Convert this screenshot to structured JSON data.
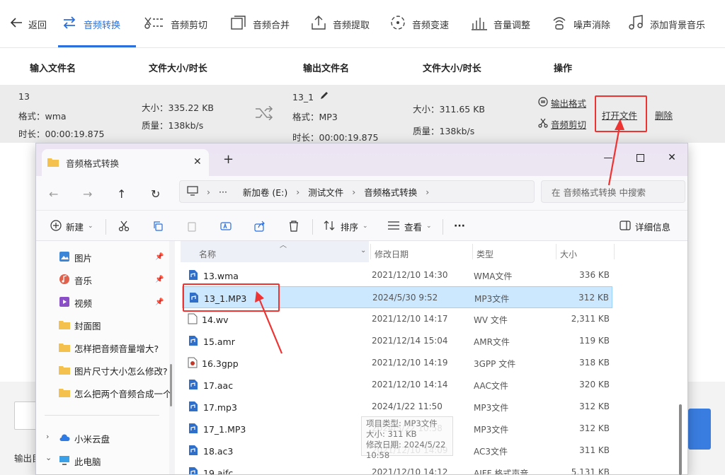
{
  "toolbar": {
    "back_label": "返回",
    "items": [
      {
        "label": "音频转换",
        "icon": "convert-icon",
        "active": true
      },
      {
        "label": "音频剪切",
        "icon": "scissors-icon"
      },
      {
        "label": "音频合并",
        "icon": "merge-icon"
      },
      {
        "label": "音频提取",
        "icon": "extract-icon"
      },
      {
        "label": "音频变速",
        "icon": "speed-icon"
      },
      {
        "label": "音量调整",
        "icon": "volume-bars-icon"
      },
      {
        "label": "噪声消除",
        "icon": "noise-icon"
      },
      {
        "label": "添加背景音乐",
        "icon": "music-note-icon"
      }
    ],
    "accent": "#2b6fdc"
  },
  "table_header": {
    "input_name": "输入文件名",
    "input_size": "文件大小/时长",
    "output_name": "输出文件名",
    "output_size": "文件大小/时长",
    "actions": "操作"
  },
  "file_row": {
    "input": {
      "name": "13",
      "format": "格式：wma",
      "duration": "时长：00:00:19.875",
      "size": "大小：335.22 KB",
      "quality": "质量：138kb/s"
    },
    "output": {
      "name": "13_1",
      "format": "格式：MP3",
      "duration": "时长：00:00:19.875",
      "size": "大小：311.65 KB",
      "quality": "质量：138kb/s"
    },
    "actions": {
      "output_format": "输出格式",
      "audio_cut": "音频剪切",
      "open_file": "打开文件",
      "delete": "删除"
    }
  },
  "bottom": {
    "output_label": "输出目"
  },
  "explorer": {
    "tab_title": "音频格式转换",
    "breadcrumb": [
      "新加卷 (E:)",
      "测试文件",
      "音频格式转换"
    ],
    "search_placeholder": "在 音频格式转换 中搜索",
    "commands": {
      "new": "新建",
      "sort": "排序",
      "view": "查看",
      "more": "···",
      "details": "详细信息"
    },
    "nav_items": [
      {
        "label": "图片",
        "icon": "pictures-icon",
        "pinned": true
      },
      {
        "label": "音乐",
        "icon": "music-icon",
        "pinned": true
      },
      {
        "label": "视频",
        "icon": "video-icon",
        "pinned": true
      },
      {
        "label": "封面图",
        "icon": "folder-icon"
      },
      {
        "label": "怎样把音频音量增大?",
        "icon": "folder-icon"
      },
      {
        "label": "图片尺寸大小怎么修改?",
        "icon": "folder-icon"
      },
      {
        "label": "怎么把两个音频合成一个",
        "icon": "folder-icon"
      },
      {
        "label": "小米云盘",
        "icon": "cloud-icon"
      },
      {
        "label": "此电脑",
        "icon": "pc-icon"
      }
    ],
    "columns": {
      "name": "名称",
      "date": "修改日期",
      "type": "类型",
      "size": "大小"
    },
    "files": [
      {
        "name": "13.wma",
        "date": "2021/12/10 14:30",
        "type": "WMA文件",
        "size": "336 KB"
      },
      {
        "name": "13_1.MP3",
        "date": "2024/5/30 9:52",
        "type": "MP3文件",
        "size": "312 KB",
        "selected": true
      },
      {
        "name": "14.wv",
        "date": "2021/12/10 14:17",
        "type": "WV 文件",
        "size": "2,311 KB"
      },
      {
        "name": "15.amr",
        "date": "2021/12/14 15:04",
        "type": "AMR文件",
        "size": "119 KB"
      },
      {
        "name": "16.3gpp",
        "date": "2021/12/10 14:19",
        "type": "3GPP 文件",
        "size": "318 KB"
      },
      {
        "name": "17.aac",
        "date": "2021/12/10 14:14",
        "type": "AAC文件",
        "size": "320 KB"
      },
      {
        "name": "17.mp3",
        "date": "2024/1/22 11:50",
        "type": "MP3文件",
        "size": "312 KB"
      },
      {
        "name": "17_1.MP3",
        "date": "2024/5/22 10:58",
        "type": "MP3文件",
        "size": "312 KB"
      },
      {
        "name": "18.ac3",
        "date": "2021/12/10 14:09",
        "type": "AC3文件",
        "size": "311 KB"
      },
      {
        "name": "19.aifc",
        "date": "2021/12/10 14:12",
        "type": "AIFF 格式声音",
        "size": "5,131 KB"
      }
    ],
    "tooltip": {
      "type": "项目类型: MP3文件",
      "size": "大小: 311 KB",
      "date": "修改日期: 2024/5/22 10:58"
    }
  }
}
